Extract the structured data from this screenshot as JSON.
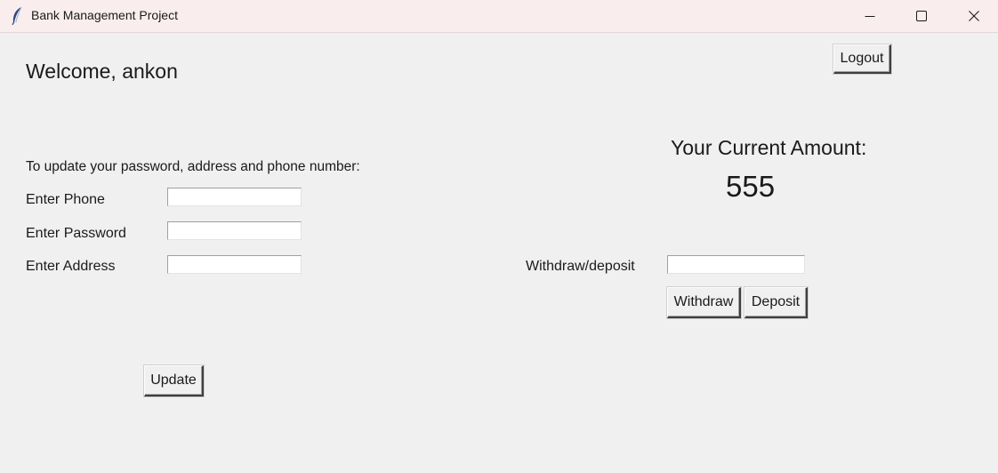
{
  "window": {
    "title": "Bank Management Project",
    "icon": "feather-icon"
  },
  "header": {
    "welcome": "Welcome, ankon",
    "logout_label": "Logout"
  },
  "update_form": {
    "instructions": "To update your password, address and phone number:",
    "phone_label": "Enter Phone",
    "phone_value": "",
    "password_label": "Enter Password",
    "password_value": "",
    "address_label": "Enter Address",
    "address_value": "",
    "update_label": "Update"
  },
  "account": {
    "amount_title": "Your Current Amount:",
    "amount_value": "555"
  },
  "transaction": {
    "label": "Withdraw/deposit",
    "value": "",
    "withdraw_label": "Withdraw",
    "deposit_label": "Deposit"
  }
}
